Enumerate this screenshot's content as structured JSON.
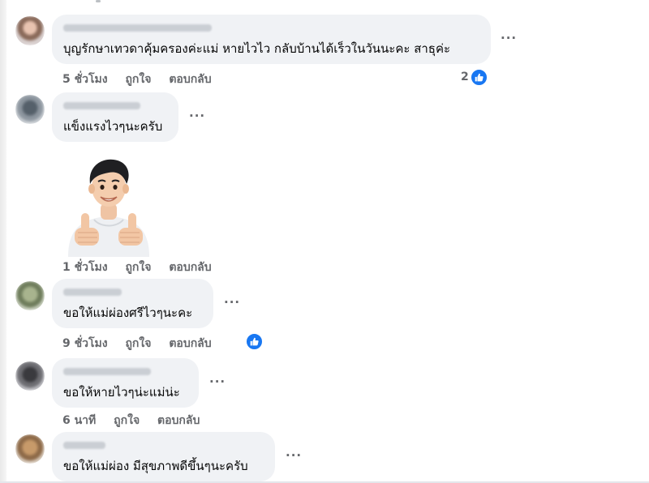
{
  "comments": [
    {
      "text": "บุญรักษาเทวดาคุ้มครองค่ะแม่ หายไวไว กลับบ้านได้เร็วในวันนะคะ สาธุค่ะ",
      "time": "5 ชั่วโมง",
      "like_label": "ถูกใจ",
      "reply_label": "ตอบกลับ",
      "reaction_count": "2"
    },
    {
      "text": "แข็งแรงไวๆนะครับ",
      "time": "1 ชั่วโมง",
      "like_label": "ถูกใจ",
      "reply_label": "ตอบกลับ"
    },
    {
      "text": "ขอให้แม่ผ่องศรีไวๆนะคะ",
      "time": "9 ชั่วโมง",
      "like_label": "ถูกใจ",
      "reply_label": "ตอบกลับ"
    },
    {
      "text": "ขอให้หายไวๆน่ะแม่น่ะ",
      "time": "6 นาที",
      "like_label": "ถูกใจ",
      "reply_label": "ตอบกลับ"
    },
    {
      "text": "ขอให้แม่ผ่อง มีสุขภาพดีขึ้นๆนะครับ"
    }
  ],
  "more_options": "···",
  "colors": {
    "bubble": "#f0f2f5",
    "meta_text": "#65676b",
    "like_blue": "#1877f2"
  },
  "icons": [
    "like-reaction-icon",
    "thumbs-up-sticker"
  ]
}
